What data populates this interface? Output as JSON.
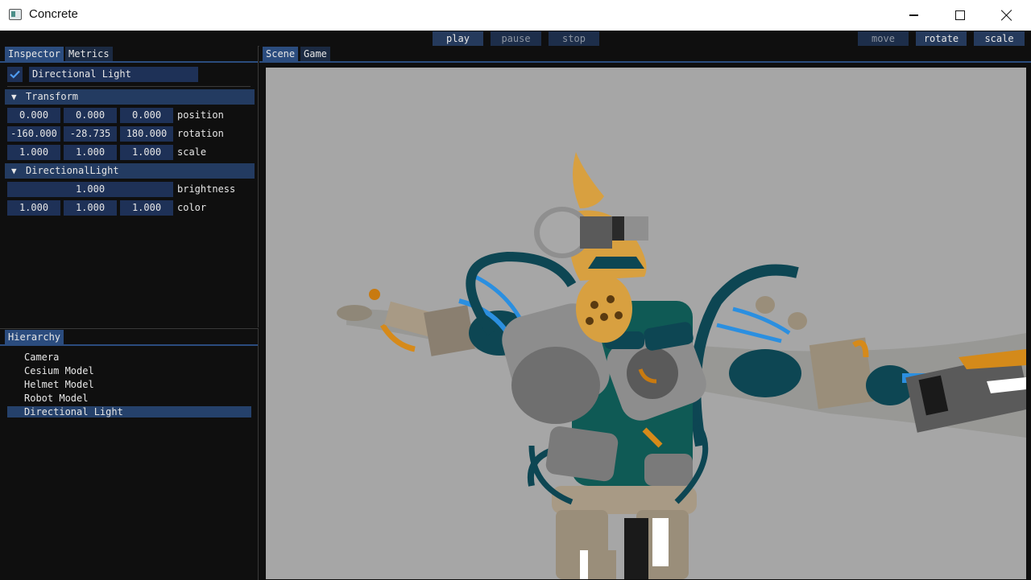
{
  "window": {
    "title": "Concrete",
    "icon": "app-window-icon"
  },
  "toolbar": {
    "play": "play",
    "pause": "pause",
    "stop": "stop",
    "move": "move",
    "rotate": "rotate",
    "scale": "scale"
  },
  "inspector": {
    "tabs": [
      "Inspector",
      "Metrics"
    ],
    "entity_enabled": true,
    "entity_name": "Directional Light",
    "transform": {
      "header": "Transform",
      "position": [
        "0.000",
        "0.000",
        "0.000"
      ],
      "position_label": "position",
      "rotation": [
        "-160.000",
        "-28.735",
        "180.000"
      ],
      "rotation_label": "rotation",
      "scale": [
        "1.000",
        "1.000",
        "1.000"
      ],
      "scale_label": "scale"
    },
    "light": {
      "header": "DirectionalLight",
      "brightness": "1.000",
      "brightness_label": "brightness",
      "color": [
        "1.000",
        "1.000",
        "1.000"
      ],
      "color_label": "color"
    }
  },
  "hierarchy": {
    "tab": "Hierarchy",
    "items": [
      "Camera",
      "Cesium Model",
      "Helmet Model",
      "Robot Model",
      "Directional Light"
    ],
    "selected": "Directional Light"
  },
  "scene": {
    "tabs": [
      "Scene",
      "Game"
    ],
    "viewport": "3d-robot-model-render"
  },
  "colors": {
    "accent": "#2b4c7e",
    "field": "#1e3157",
    "header": "#233b61",
    "viewport_bg": "#a6a6a6"
  }
}
